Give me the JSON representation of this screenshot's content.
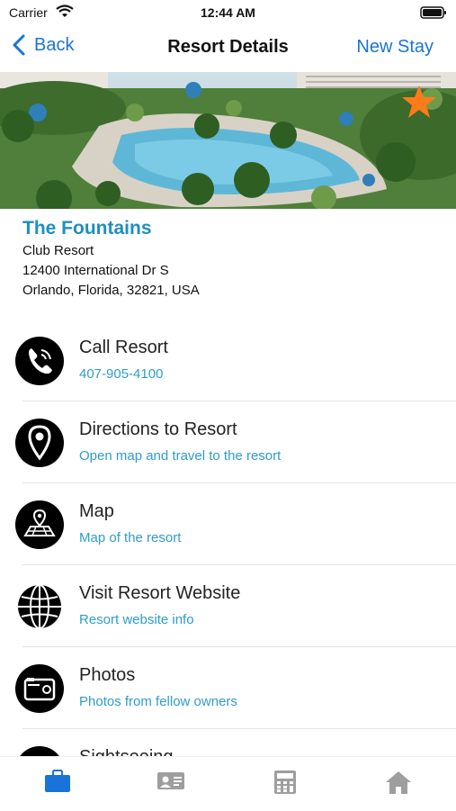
{
  "status_bar": {
    "carrier": "Carrier",
    "time": "12:44 AM"
  },
  "nav": {
    "back_label": "Back",
    "title": "Resort Details",
    "right_button": "New Stay"
  },
  "resort": {
    "name": "The Fountains",
    "type": "Club Resort",
    "address_line1": "12400 International Dr S",
    "address_line2": "Orlando, Florida, 32821, USA",
    "favorite": true
  },
  "menu": [
    {
      "title": "Call Resort",
      "subtitle": "407-905-4100",
      "icon": "phone-icon"
    },
    {
      "title": "Directions to Resort",
      "subtitle": "Open map and travel to the resort",
      "icon": "location-pin-icon"
    },
    {
      "title": "Map",
      "subtitle": "Map of the resort",
      "icon": "map-icon"
    },
    {
      "title": "Visit Resort Website",
      "subtitle": "Resort website info",
      "icon": "globe-icon"
    },
    {
      "title": "Photos",
      "subtitle": "Photos from fellow owners",
      "icon": "camera-icon"
    },
    {
      "title": "Sightseeing",
      "subtitle": "",
      "icon": "sightseeing-icon"
    }
  ],
  "tabs": [
    {
      "name": "briefcase-icon",
      "active": true
    },
    {
      "name": "id-card-icon",
      "active": false
    },
    {
      "name": "calculator-icon",
      "active": false
    },
    {
      "name": "home-icon",
      "active": false
    }
  ],
  "colors": {
    "accent": "#1a73d8",
    "resort_name": "#1e8fc0",
    "subtitle": "#2e9ccc",
    "star": "#ff7a1a"
  }
}
